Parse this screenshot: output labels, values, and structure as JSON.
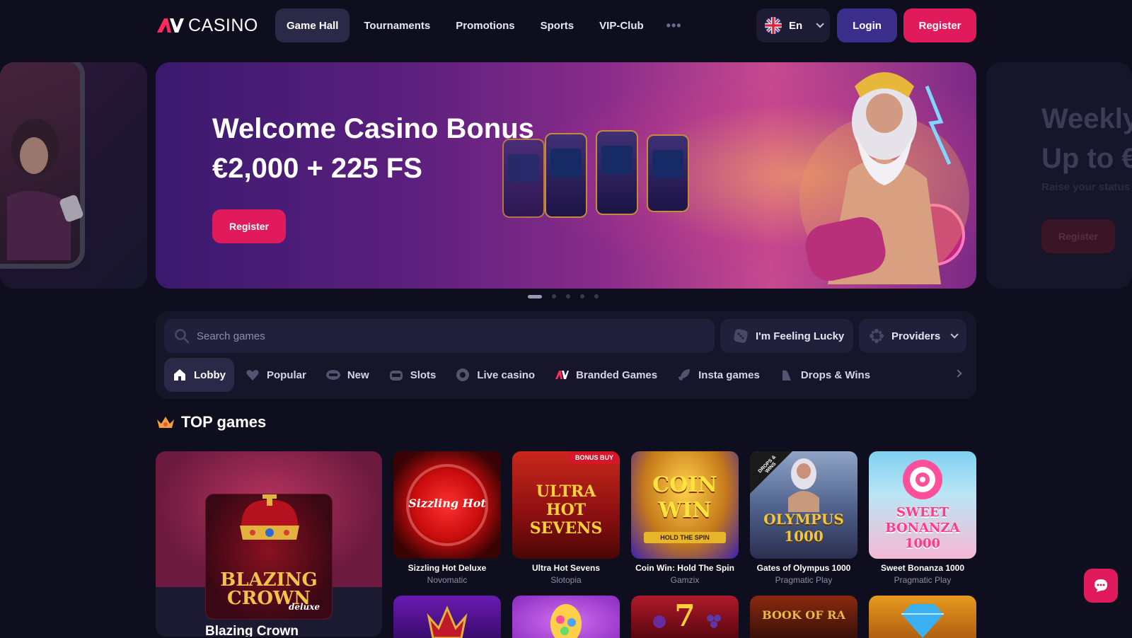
{
  "header": {
    "logo_text": "CASINO",
    "nav": [
      {
        "label": "Game Hall",
        "active": true
      },
      {
        "label": "Tournaments"
      },
      {
        "label": "Promotions"
      },
      {
        "label": "Sports"
      },
      {
        "label": "VIP-Club"
      }
    ],
    "more": "•••",
    "language": "En",
    "login": "Login",
    "register": "Register"
  },
  "hero": {
    "title_line1": "Welcome Casino Bonus",
    "title_line2": "€2,000 + 225 FS",
    "cta": "Register",
    "slides_count": 5,
    "active_slide": 1
  },
  "next_slide": {
    "title_line1": "Weekly",
    "title_line2": "Up to €",
    "subtitle": "Raise your status",
    "cta": "Register"
  },
  "search": {
    "placeholder": "Search games",
    "lucky": "I'm Feeling Lucky",
    "providers": "Providers"
  },
  "categories": [
    {
      "label": "Lobby",
      "icon": "home-icon",
      "active": true
    },
    {
      "label": "Popular",
      "icon": "heart-icon"
    },
    {
      "label": "New",
      "icon": "new-badge-icon"
    },
    {
      "label": "Slots",
      "icon": "slot-machine-icon"
    },
    {
      "label": "Live casino",
      "icon": "chip-icon"
    },
    {
      "label": "Branded Games",
      "icon": "brand-logo-icon"
    },
    {
      "label": "Insta games",
      "icon": "rocket-icon"
    },
    {
      "label": "Drops & Wins",
      "icon": "drops-icon"
    }
  ],
  "top_games": {
    "title": "TOP games",
    "featured": {
      "name": "Blazing Crown",
      "art_text_1": "BLAZING",
      "art_text_2": "CROWN",
      "art_text_3": "deluxe"
    },
    "games": [
      {
        "name": "Sizzling Hot Deluxe",
        "provider": "Novomatic",
        "art_text": "Sizzling Hot"
      },
      {
        "name": "Ultra Hot Sevens",
        "provider": "Slotopia",
        "art_text": "ULTRA HOT SEVENS",
        "badge": "BONUS BUY"
      },
      {
        "name": "Coin Win: Hold The Spin",
        "provider": "Gamzix",
        "art_text": "COIN WIN",
        "art_sub": "HOLD THE SPIN"
      },
      {
        "name": "Gates of Olympus 1000",
        "provider": "Pragmatic Play",
        "art_text": "OLYMPUS 1000",
        "badge": "DROPS & WINS"
      },
      {
        "name": "Sweet Bonanza 1000",
        "provider": "Pragmatic Play",
        "art_text": "SWEET BONANZA 1000"
      }
    ],
    "row2_art": [
      "",
      "",
      "",
      "BOOK OF RA",
      ""
    ]
  },
  "colors": {
    "background": "#0f0e1e",
    "accent": "#e11a5c",
    "login": "#3c2f8c",
    "panel": "#16152a"
  }
}
